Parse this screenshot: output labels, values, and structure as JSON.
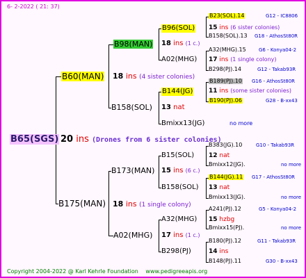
{
  "header": {
    "date": "6-  2-2022 ( 21: 37)"
  },
  "root": {
    "name": "B65(SGS)",
    "count": "20",
    "ins": "ins",
    "note": "(Drones from 6 sister colonies)"
  },
  "gen1": [
    {
      "name": "B60(MAN)",
      "count": "18",
      "ins": "ins",
      "note": "(4 sister colonies)"
    },
    {
      "name": "B175(MAN)",
      "count": "18",
      "ins": "ins",
      "note": "(1 single colony)"
    }
  ],
  "gen2": [
    {
      "name": "B98(MAN)",
      "count": "18",
      "ins": "ins",
      "note": "(1 c.)"
    },
    {
      "name": "B158(SOL)",
      "count": "13",
      "ins": "nat",
      "note": ""
    },
    {
      "name": "B173(MAN)",
      "count": "15",
      "ins": "ins",
      "note": "(6 c.)"
    },
    {
      "name": "A02(MHG)",
      "count": "17",
      "ins": "ins",
      "note": "(1 c.)"
    }
  ],
  "gen3": [
    {
      "name": "B96(SOL)",
      "count": "15",
      "ins": "ins",
      "note": "(6 sister colonies)"
    },
    {
      "name": "A02(MHG)",
      "count": "17",
      "ins": "ins",
      "note": "(1 single colony)"
    },
    {
      "name": "B144(JG)",
      "count": "11",
      "ins": "ins",
      "note": "(some sister colonies)"
    },
    {
      "name": "Bmixx13(JG)",
      "count": "",
      "ins": "",
      "note": "no more"
    },
    {
      "name": "B15(SOL)",
      "count": "12",
      "ins": "nat",
      "note": ""
    },
    {
      "name": "B158(SOL)",
      "count": "13",
      "ins": "nat",
      "note": ""
    },
    {
      "name": "A32(MHG)",
      "count": "15",
      "ins": "hzbg",
      "note": ""
    },
    {
      "name": "B298(PJ)",
      "count": "14",
      "ins": "ins",
      "note": ""
    }
  ],
  "gen4": [
    {
      "name": "B23(SOL).14",
      "right": "G12 - IC8806"
    },
    {
      "name": "B158(SOL).13",
      "right": "G18 - AthosSt80R"
    },
    {
      "name": "A32(MHG).15",
      "right": "G6 - Konya04-2"
    },
    {
      "name": "B298(PJ).14",
      "right": "G12 - Takab93R"
    },
    {
      "name": "B189(PJ).10",
      "right": "G16 - AthosSt80R"
    },
    {
      "name": "B190(PJ).06",
      "right": "G28 - B-xx43"
    },
    {
      "name": "B383(JG).10",
      "right": "G10 - Takab93R"
    },
    {
      "name": "Bmixx12(JG).",
      "right": "no more"
    },
    {
      "name": "B144(JG).11",
      "right": "G17 - AthosSt80R"
    },
    {
      "name": "Bmixx13(JG).",
      "right": "no more"
    },
    {
      "name": "A241(PJ).12",
      "right": "G5 - Konya04-2"
    },
    {
      "name": "Bmixx15(PJ).",
      "right": "no more"
    },
    {
      "name": "B180(PJ).12",
      "right": "G11 - Takab93R"
    },
    {
      "name": "B148(PJ).11",
      "right": "G30 - B-xx43"
    }
  ],
  "footer": {
    "copyright": "Copyright 2004-2022 @ Karl Kehrle Foundation",
    "site": "www.pedigreeapis.org"
  },
  "colors": {
    "border": "#e000e0",
    "highlight_yellow": "#ffff00",
    "highlight_green": "#33cc33",
    "highlight_gray": "#bdbdbd",
    "ins_red": "#e00000",
    "note_purple": "#7a1fcf",
    "link_blue": "#0000cc"
  }
}
